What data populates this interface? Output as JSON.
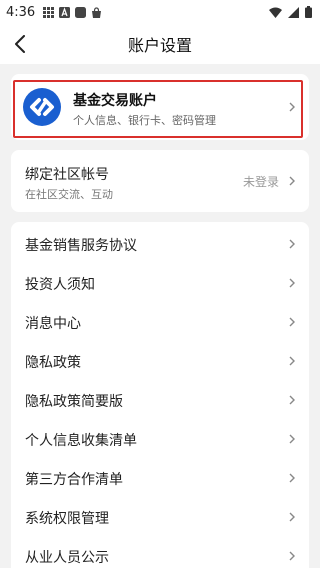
{
  "status_bar": {
    "time": "4:36",
    "left_icons": [
      "grid-icon",
      "a-icon",
      "square-icon",
      "bag-icon"
    ],
    "right_icons": [
      "wifi-icon",
      "signal-icon",
      "battery-icon"
    ]
  },
  "nav": {
    "title": "账户设置",
    "back_icon": "back-arrow-icon"
  },
  "account": {
    "title": "基金交易账户",
    "subtitle": "个人信息、银行卡、密码管理",
    "logo_icon": "fund-logo-icon",
    "highlight_color": "#d9302c"
  },
  "community": {
    "title": "绑定社区帐号",
    "subtitle": "在社区交流、互动",
    "status": "未登录"
  },
  "menu": {
    "items": [
      {
        "label": "基金销售服务协议"
      },
      {
        "label": "投资人须知"
      },
      {
        "label": "消息中心"
      },
      {
        "label": "隐私政策"
      },
      {
        "label": "隐私政策简要版"
      },
      {
        "label": "个人信息收集清单"
      },
      {
        "label": "第三方合作清单"
      },
      {
        "label": "系统权限管理"
      },
      {
        "label": "从业人员公示"
      }
    ]
  },
  "colors": {
    "background": "#f2f2f2",
    "card": "#ffffff",
    "logo_blue": "#1a5fd0",
    "text_primary": "#222222",
    "text_secondary": "#777777"
  }
}
